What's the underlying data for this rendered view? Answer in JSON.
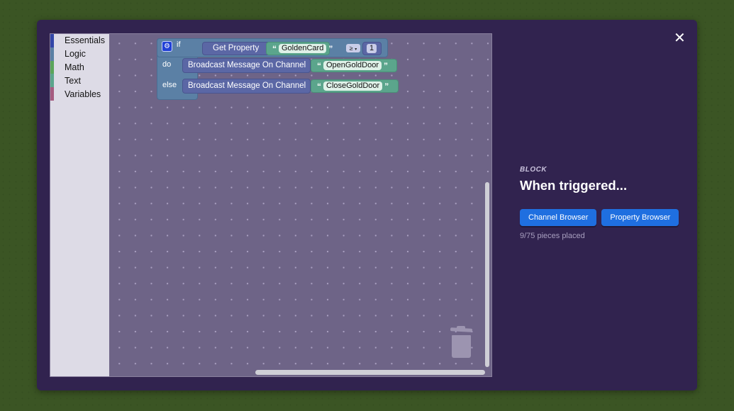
{
  "toolbox": {
    "items": [
      {
        "label": "Essentials",
        "color": "#3346a8"
      },
      {
        "label": "Logic",
        "color": "#5b80a5"
      },
      {
        "label": "Math",
        "color": "#5ba55b"
      },
      {
        "label": "Text",
        "color": "#5ba58c"
      },
      {
        "label": "Variables",
        "color": "#a55b80"
      }
    ]
  },
  "blocks": {
    "if_keyword": "if",
    "do_keyword": "do",
    "else_keyword": "else",
    "get_property_label": "Get Property",
    "property_name": "GoldenCard",
    "operator": "≥",
    "operator_dropdown": "▾",
    "compare_value": "1",
    "broadcast_label": "Broadcast Message On Channel",
    "do_channel": "OpenGoldDoor",
    "else_channel": "CloseGoldDoor",
    "open_quote": "“",
    "close_quote": "”"
  },
  "panel": {
    "eyebrow": "BLOCK",
    "title": "When triggered...",
    "channel_browser_label": "Channel Browser",
    "property_browser_label": "Property Browser",
    "progress_text": "9/75 pieces placed",
    "pieces_placed": 9,
    "pieces_total": 75
  },
  "icons": {
    "close": "✕",
    "gear": "⚙"
  }
}
